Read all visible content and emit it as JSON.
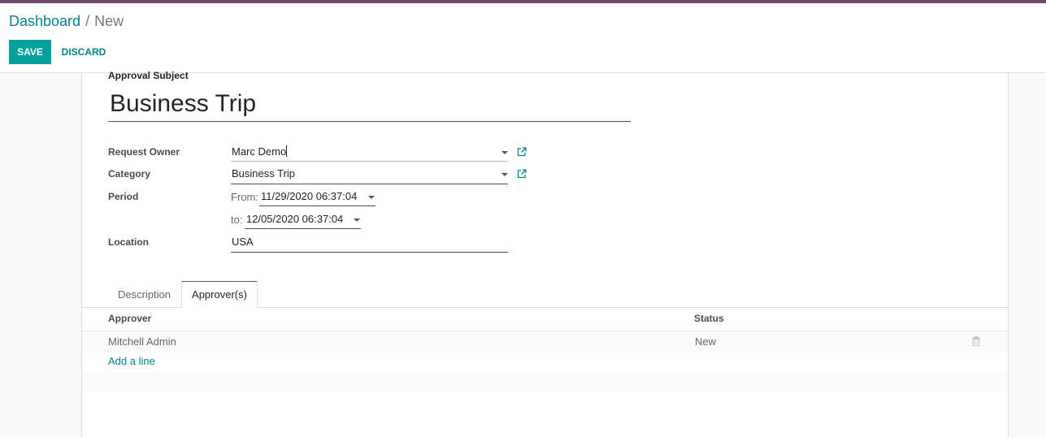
{
  "breadcrumb": {
    "parent": "Dashboard",
    "separator": "/",
    "current": "New"
  },
  "toolbar": {
    "save_label": "SAVE",
    "discard_label": "DISCARD"
  },
  "form": {
    "subject_label": "Approval Subject",
    "subject_value": "Business Trip",
    "request_owner_label": "Request Owner",
    "request_owner_value": "Marc Demo",
    "category_label": "Category",
    "category_value": "Business Trip",
    "period_label": "Period",
    "period_from_label": "From:",
    "period_from_value": "11/29/2020 06:37:04",
    "period_to_label": "to:",
    "period_to_value": "12/05/2020 06:37:04",
    "location_label": "Location",
    "location_value": "USA"
  },
  "tabs": [
    {
      "label": "Description",
      "active": false
    },
    {
      "label": "Approver(s)",
      "active": true
    }
  ],
  "approvers": {
    "columns": [
      "Approver",
      "Status"
    ],
    "rows": [
      {
        "approver": "Mitchell Admin",
        "status": "New"
      }
    ],
    "add_line_label": "Add a line"
  },
  "icons": {
    "external": "external-link-icon",
    "dropdown": "caret-down-icon",
    "delete": "trash-icon"
  },
  "colors": {
    "brand": "#714b67",
    "primary": "#00a09d",
    "link": "#00848a"
  }
}
